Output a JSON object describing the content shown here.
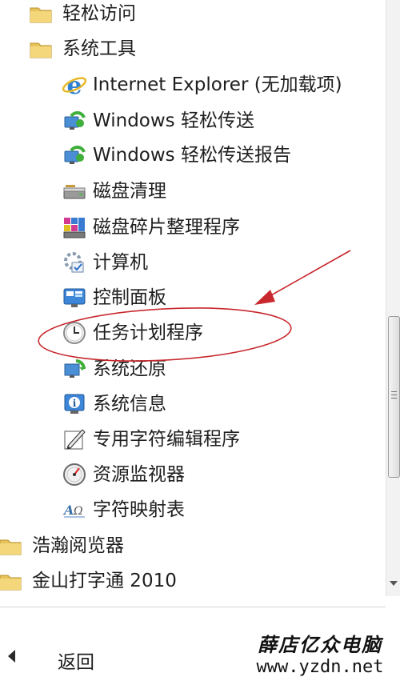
{
  "menu": {
    "items": [
      {
        "label": "轻松访问",
        "icon": "folder-icon",
        "kind": "folder"
      },
      {
        "label": "系统工具",
        "icon": "folder-icon",
        "kind": "folder"
      },
      {
        "label": "Internet Explorer (无加载项)",
        "icon": "internet-explorer-icon",
        "kind": "program"
      },
      {
        "label": "Windows 轻松传送",
        "icon": "easy-transfer-icon",
        "kind": "program"
      },
      {
        "label": "Windows 轻松传送报告",
        "icon": "easy-transfer-report-icon",
        "kind": "program"
      },
      {
        "label": "磁盘清理",
        "icon": "disk-cleanup-icon",
        "kind": "program"
      },
      {
        "label": "磁盘碎片整理程序",
        "icon": "disk-defragmenter-icon",
        "kind": "program"
      },
      {
        "label": "计算机",
        "icon": "computer-icon",
        "kind": "program"
      },
      {
        "label": "控制面板",
        "icon": "control-panel-icon",
        "kind": "program"
      },
      {
        "label": "任务计划程序",
        "icon": "task-scheduler-icon",
        "kind": "program"
      },
      {
        "label": "系统还原",
        "icon": "system-restore-icon",
        "kind": "program"
      },
      {
        "label": "系统信息",
        "icon": "system-information-icon",
        "kind": "program"
      },
      {
        "label": "专用字符编辑程序",
        "icon": "private-character-editor-icon",
        "kind": "program"
      },
      {
        "label": "资源监视器",
        "icon": "resource-monitor-icon",
        "kind": "program"
      },
      {
        "label": "字符映射表",
        "icon": "character-map-icon",
        "kind": "program"
      },
      {
        "label": "浩瀚阅览器",
        "icon": "folder-icon",
        "kind": "folder"
      },
      {
        "label": "金山打字通 2010",
        "icon": "folder-icon",
        "kind": "folder"
      }
    ]
  },
  "back": {
    "label": "返回",
    "icon": "back-arrow-icon"
  },
  "watermark": {
    "title": "薛店亿众电脑",
    "url": "www.yzdn.net"
  },
  "annotation": {
    "color": "#c8282d",
    "highlighted_item": "任务计划程序"
  },
  "colors": {
    "folder": "#e8c25a",
    "text": "#1e1e1e",
    "scrollbar_thumb": "#dcdcdc"
  }
}
